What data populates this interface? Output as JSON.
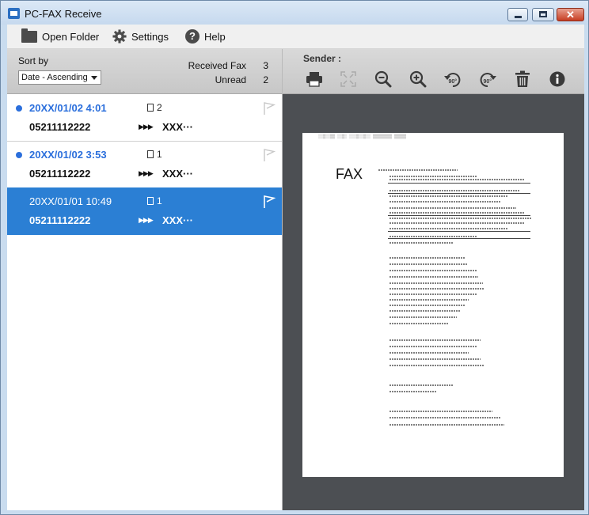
{
  "window": {
    "title": "PC-FAX Receive"
  },
  "menu": {
    "items": [
      {
        "label": "Open Folder",
        "icon": "folder-icon"
      },
      {
        "label": "Settings",
        "icon": "gear-icon"
      },
      {
        "label": "Help",
        "icon": "help-icon"
      }
    ]
  },
  "list_panel": {
    "sort_label": "Sort by",
    "sort_value": "Date - Ascending",
    "received_label": "Received Fax",
    "received_count": "3",
    "unread_label": "Unread",
    "unread_count": "2"
  },
  "faxes": [
    {
      "date": "20XX/01/02 4:01",
      "pages": "2",
      "number": "05211112222",
      "sender": "XXX···",
      "unread": true,
      "selected": false
    },
    {
      "date": "20XX/01/02 3:53",
      "pages": "1",
      "number": "05211112222",
      "sender": "XXX···",
      "unread": true,
      "selected": false
    },
    {
      "date": "20XX/01/01 10:49",
      "pages": "1",
      "number": "05211112222",
      "sender": "XXX···",
      "unread": false,
      "selected": true
    }
  ],
  "viewer": {
    "sender_label": "Sender :",
    "tools": [
      "print-icon",
      "fit-page-icon",
      "zoom-out-icon",
      "zoom-in-icon",
      "rotate-left-90-icon",
      "rotate-right-90-icon",
      "delete-icon",
      "info-icon"
    ],
    "rotate_label": "90°",
    "page_logo": "FAX"
  },
  "colors": {
    "accent": "#2b7fd4",
    "unread_dot": "#2b6fdc",
    "viewer_bg": "#4c4f53"
  }
}
